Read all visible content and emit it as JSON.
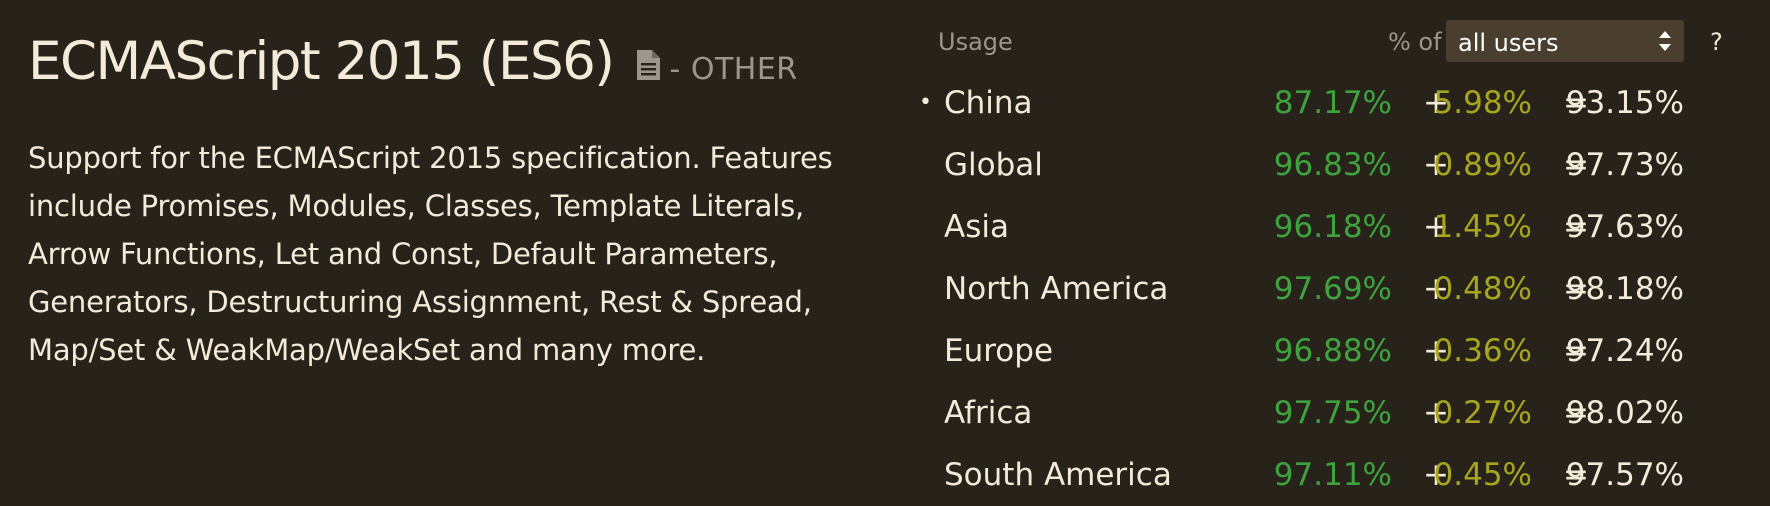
{
  "feature": {
    "title": "ECMAScript 2015 (ES6)",
    "status": "- OTHER",
    "spec_icon": "document-icon",
    "description": "Support for the ECMAScript 2015 specification. Features include Promises, Modules, Classes, Template Literals, Arrow Functions, Let and Const, Default Parameters, Generators, Destructuring Assignment, Rest & Spread, Map/Set & WeakMap/WeakSet and many more."
  },
  "usage": {
    "label": "Usage",
    "pct_of_label": "% of",
    "select_value": "all users",
    "help_label": "?",
    "colors": {
      "full_support": "#3ea33e",
      "partial_support": "#a8a51e"
    },
    "rows": [
      {
        "bullet": "•",
        "region": "China",
        "full": "87.17%",
        "plus": "+",
        "partial": "5.98%",
        "eq": "=",
        "total": "93.15%"
      },
      {
        "bullet": "",
        "region": "Global",
        "full": "96.83%",
        "plus": "+",
        "partial": "0.89%",
        "eq": "=",
        "total": "97.73%"
      },
      {
        "bullet": "",
        "region": "Asia",
        "full": "96.18%",
        "plus": "+",
        "partial": "1.45%",
        "eq": "=",
        "total": "97.63%"
      },
      {
        "bullet": "",
        "region": "North America",
        "full": "97.69%",
        "plus": "+",
        "partial": "0.48%",
        "eq": "=",
        "total": "98.18%"
      },
      {
        "bullet": "",
        "region": "Europe",
        "full": "96.88%",
        "plus": "+",
        "partial": "0.36%",
        "eq": "=",
        "total": "97.24%"
      },
      {
        "bullet": "",
        "region": "Africa",
        "full": "97.75%",
        "plus": "+",
        "partial": "0.27%",
        "eq": "=",
        "total": "98.02%"
      },
      {
        "bullet": "",
        "region": "South America",
        "full": "97.11%",
        "plus": "+",
        "partial": "0.45%",
        "eq": "=",
        "total": "97.57%"
      }
    ]
  }
}
